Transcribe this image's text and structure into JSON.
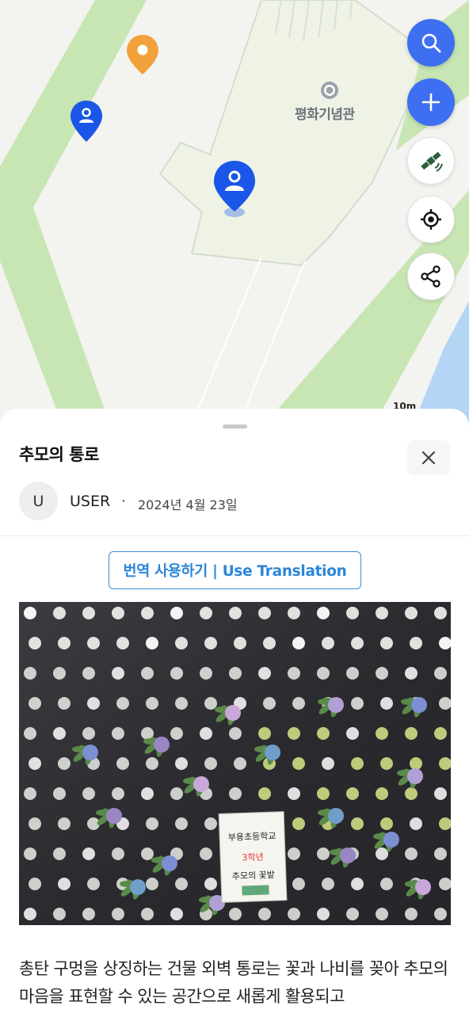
{
  "map": {
    "place_label": "평화기념관",
    "scale_label": "10m",
    "colors": {
      "park": "#c8e6b4",
      "water": "#b5d5f5",
      "building": "#eef4e8",
      "pin_blue": "#1a56e8",
      "pin_orange": "#f2a23c"
    }
  },
  "map_controls": [
    {
      "name": "search-button",
      "icon": "search-icon"
    },
    {
      "name": "add-button",
      "icon": "plus-icon"
    },
    {
      "name": "satellite-button",
      "icon": "satellite-icon"
    },
    {
      "name": "my-location-button",
      "icon": "location-target-icon"
    },
    {
      "name": "share-button",
      "icon": "share-icon"
    }
  ],
  "post": {
    "title": "추모의 통로",
    "author_initial": "U",
    "author": "USER",
    "separator": "·",
    "date": "2024년 4월 23일",
    "translate_label": "번역 사용하기 | Use Translation",
    "photo_sign": [
      "부용초등학교",
      "3학년",
      "추모의 꽃밭"
    ],
    "body": "총탄 구멍을 상징하는 건물 외벽 통로는 꽃과 나비를 꽂아 추모의 마음을 표현할 수 있는 공간으로 새롭게 활용되고"
  }
}
